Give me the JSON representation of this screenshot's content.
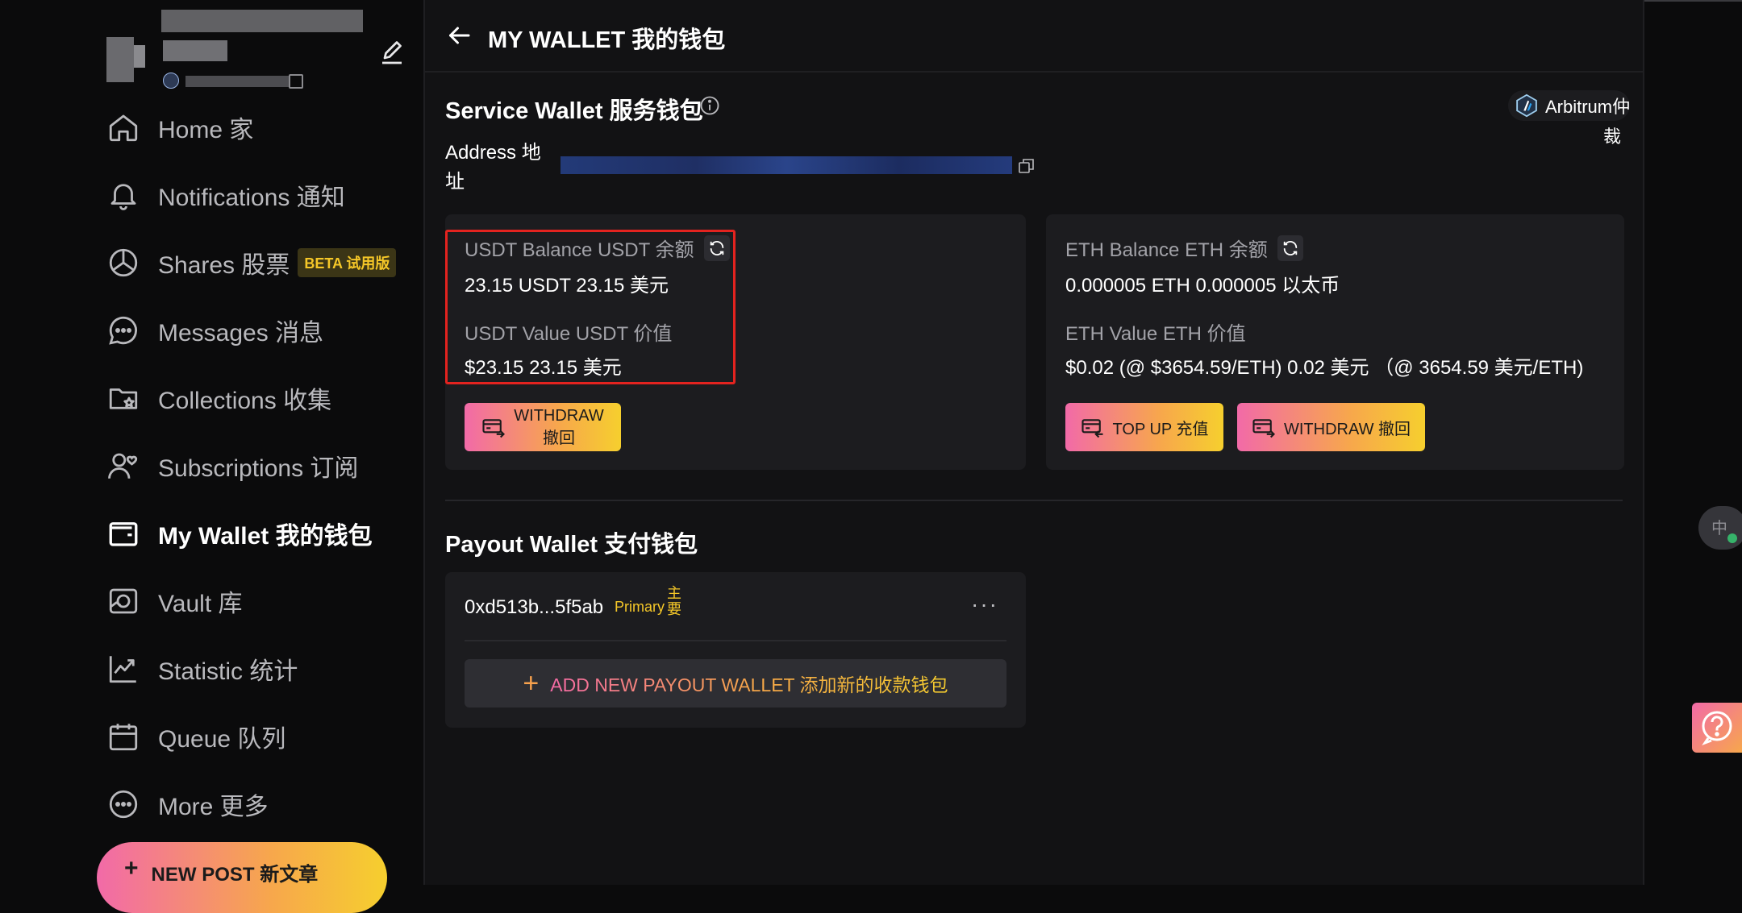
{
  "sidebar": {
    "items": [
      {
        "label": "Home 家",
        "icon": "home-icon"
      },
      {
        "label": "Notifications 通知",
        "icon": "bell-icon"
      },
      {
        "label": "Shares 股票",
        "icon": "pie-chart-icon",
        "badge": "BETA 试用版"
      },
      {
        "label": "Messages 消息",
        "icon": "message-icon"
      },
      {
        "label": "Collections 收集",
        "icon": "folder-star-icon"
      },
      {
        "label": "Subscriptions 订阅",
        "icon": "subscriptions-icon"
      },
      {
        "label": "My Wallet 我的钱包",
        "icon": "wallet-icon",
        "active": true
      },
      {
        "label": "Vault 库",
        "icon": "vault-icon"
      },
      {
        "label": "Statistic 统计",
        "icon": "chart-line-icon"
      },
      {
        "label": "Queue 队列",
        "icon": "calendar-icon"
      },
      {
        "label": "More 更多",
        "icon": "more-circle-icon"
      }
    ],
    "new_post_label": "NEW POST 新文章"
  },
  "header": {
    "title": "MY WALLET 我的钱包"
  },
  "service_wallet": {
    "title": "Service Wallet 服务钱包",
    "network_line1": "Arbitrum仲",
    "network_line2": "裁",
    "address_label": "Address 地址",
    "usdt": {
      "balance_label": "USDT Balance USDT 余额",
      "balance_value": "23.15 USDT  23.15 美元",
      "value_label": "USDT Value USDT 价值",
      "value_value": "$23.15 23.15 美元",
      "withdraw_line1": "WITHDRAW",
      "withdraw_line2": "撤回"
    },
    "eth": {
      "balance_label": "ETH Balance ETH 余额",
      "balance_value": "0.000005 ETH  0.000005 以太币",
      "value_label": "ETH Value ETH 价值",
      "value_value": "$0.02 (@ $3654.59/ETH)  0.02 美元 （@ 3654.59 美元/ETH)",
      "topup_label": "TOP UP 充值",
      "withdraw_label": "WITHDRAW 撤回"
    }
  },
  "payout_wallet": {
    "title": "Payout Wallet 支付钱包",
    "address": "0xd513b...5f5ab",
    "primary_label": "Primary",
    "primary_cn_1": "主",
    "primary_cn_2": "要",
    "more": "···",
    "add_label": "ADD NEW PAYOUT WALLET 添加新的收款钱包",
    "add_icon": "+"
  },
  "colors": {
    "accent_gradient": [
      "#f26aa8",
      "#f7a74c",
      "#f6cf2e"
    ],
    "highlight_border": "#e3231f",
    "badge_text": "#f5c728"
  }
}
